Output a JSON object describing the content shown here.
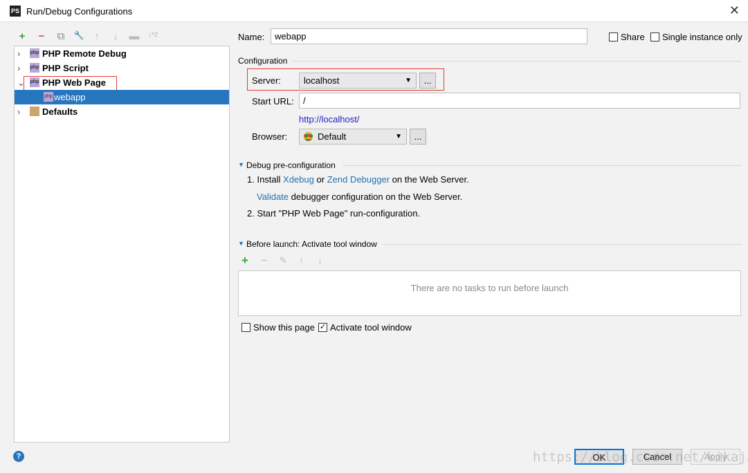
{
  "window": {
    "title": "Run/Debug Configurations",
    "app_icon": "PS"
  },
  "toolbar": {
    "add": "+",
    "remove": "−",
    "copy": "⧉",
    "wrench": "🔧",
    "up": "↑",
    "down": "↓",
    "folder": "▬",
    "sort": "↓ᵃz"
  },
  "tree": [
    {
      "label": "PHP Remote Debug",
      "expanded": false
    },
    {
      "label": "PHP Script",
      "expanded": false
    },
    {
      "label": "PHP Web Page",
      "expanded": true
    },
    {
      "label": "webapp",
      "selected": true
    },
    {
      "label": "Defaults",
      "expanded": false
    }
  ],
  "form": {
    "name_label": "Name:",
    "name_value": "webapp",
    "share": "Share",
    "share_checked": false,
    "single": "Single instance only",
    "single_checked": false,
    "configuration": "Configuration",
    "server_label": "Server:",
    "server_value": "localhost",
    "ellipsis": "...",
    "start_url_label": "Start URL:",
    "start_url_value": "/",
    "resolved_url": "http://localhost/",
    "browser_label": "Browser:",
    "browser_value": "Default"
  },
  "debug": {
    "header": "Debug pre-configuration",
    "s1_num": "1. Install",
    "xdebug": "Xdebug",
    "or": "or",
    "zend": "Zend Debugger",
    "s1_tail": "on the Web Server.",
    "validate": "Validate",
    "validate_tail": "debugger configuration on the Web Server.",
    "s2": "2. Start \"PHP Web Page\" run-configuration."
  },
  "before": {
    "header": "Before launch: Activate tool window",
    "empty": "There are no tasks to run before launch"
  },
  "footer": {
    "show_page": "Show this page",
    "show_checked": false,
    "activate": "Activate tool window",
    "activate_checked": true,
    "ok": "OK",
    "cancel": "Cancel",
    "apply": "Apply",
    "help": "?"
  },
  "watermark": "https://blog.csdn.net/kikajack",
  "colors": {
    "selection": "#2675bf",
    "link": "#2470b3",
    "highlight": "#e53935",
    "add": "#3aa13a",
    "remove": "#d9534f"
  }
}
